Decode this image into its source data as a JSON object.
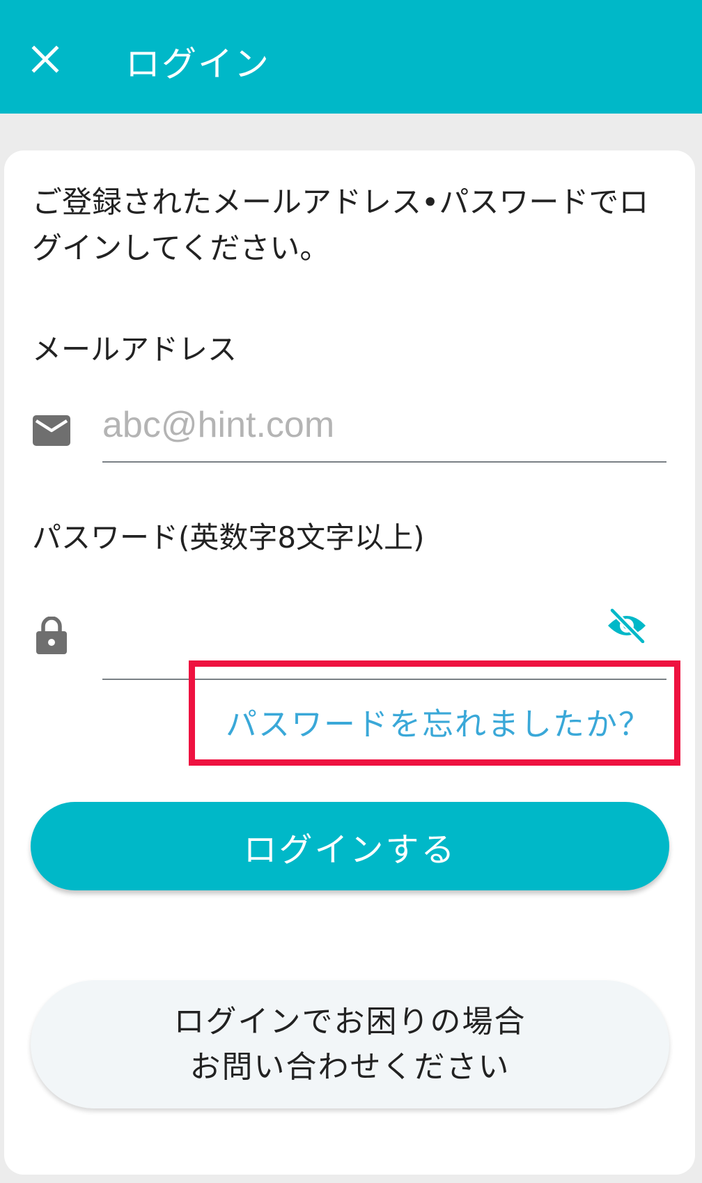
{
  "app_bar": {
    "title": "ログイン",
    "close_icon": "close-icon",
    "color": "#00b8c8"
  },
  "form": {
    "intro_text": "ご登録されたメールアドレス•パスワードでログインしてください。",
    "email": {
      "label": "メールアドレス",
      "placeholder": "abc@hint.com",
      "value": "",
      "icon": "mail-icon"
    },
    "password": {
      "label": "パスワード(英数字8文字以上)",
      "value": "",
      "icon": "lock-icon",
      "visibility_icon": "eye-off-icon"
    },
    "forgot_password_label": "パスワードを忘れましたか？",
    "login_button_label": "ログインする",
    "help": {
      "line1": "ログインでお困りの場合",
      "line2": "お問い合わせください"
    }
  },
  "colors": {
    "accent": "#00b8c8",
    "link": "#3aa8d8",
    "highlight": "#ee1240"
  }
}
